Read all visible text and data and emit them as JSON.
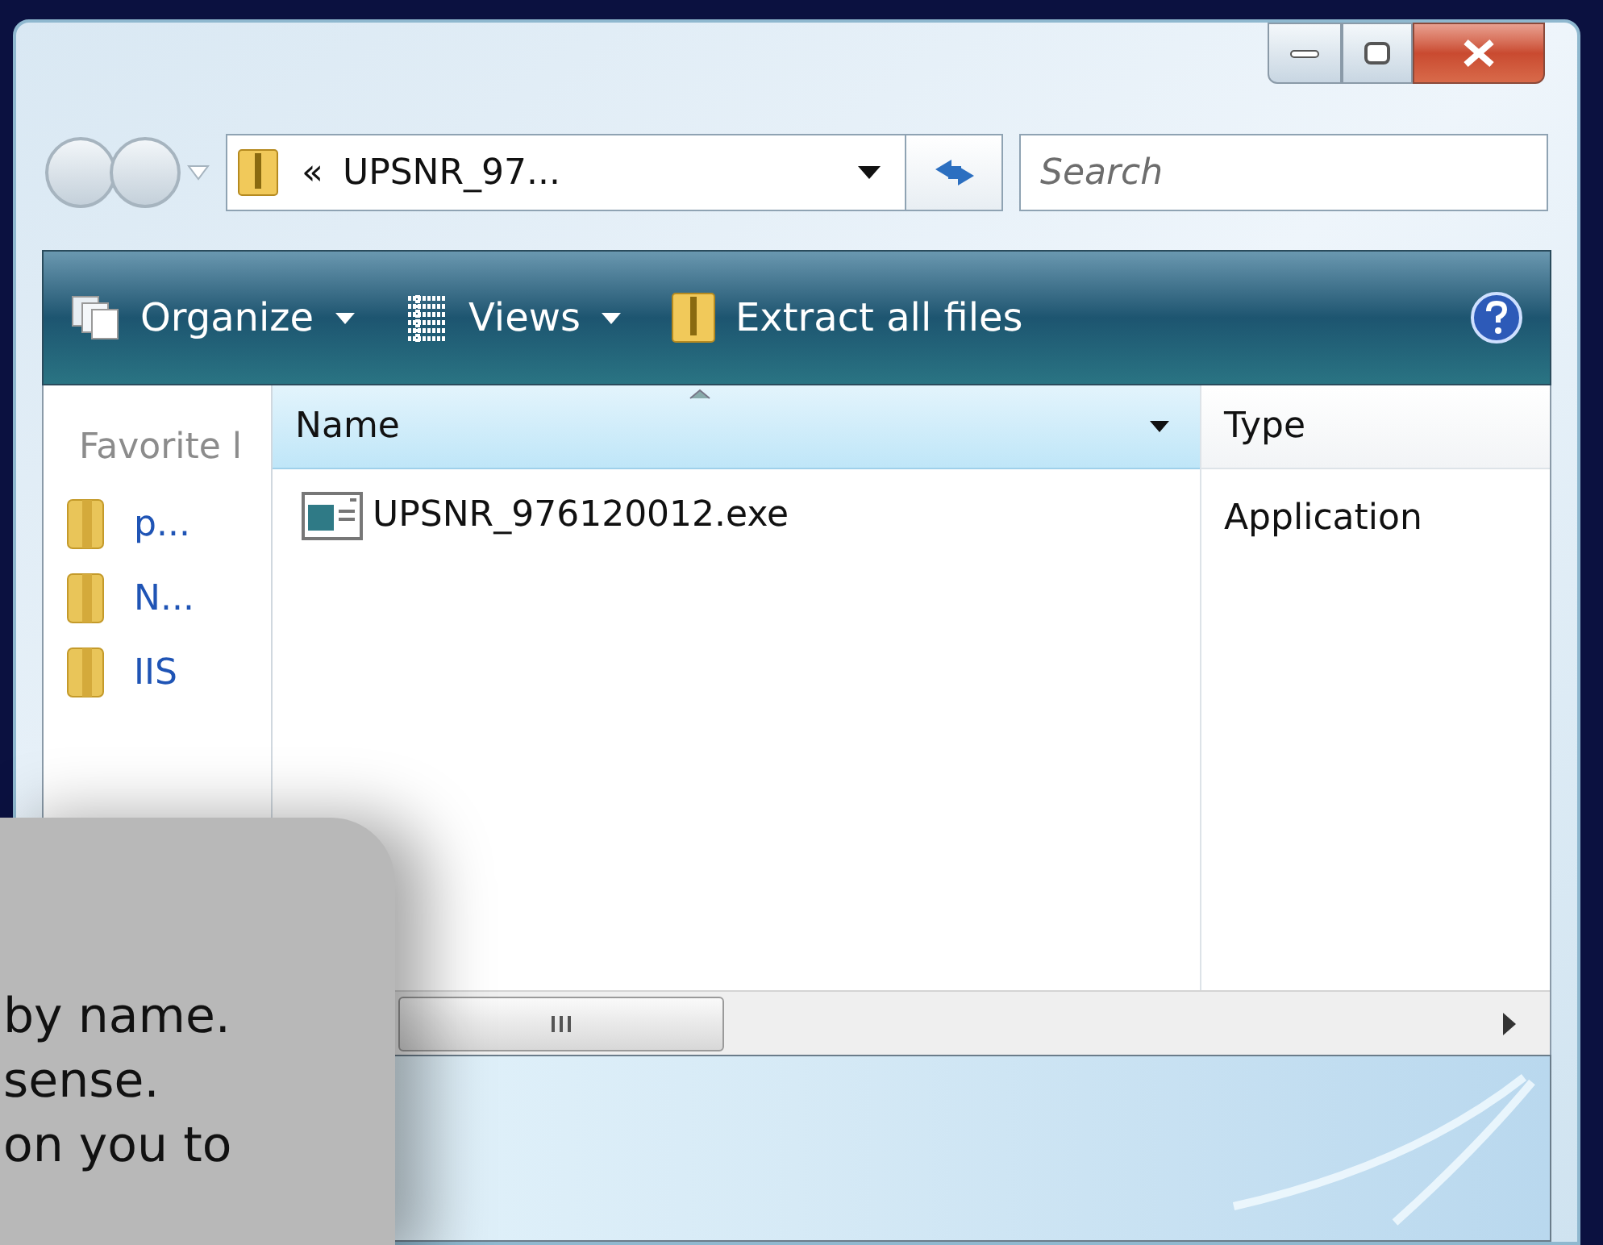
{
  "address": {
    "chevron": "«",
    "path": "UPSNR_97..."
  },
  "search": {
    "placeholder": "Search"
  },
  "toolbar": [
    {
      "label": "Organize",
      "kind": "menu"
    },
    {
      "label": "Views",
      "kind": "menu"
    },
    {
      "label": "Extract all files",
      "kind": "action"
    }
  ],
  "nav_pane": {
    "heading": "Favorite l",
    "items": [
      "p...",
      "N...",
      "IIS"
    ]
  },
  "columns": [
    {
      "label": "Name",
      "sorted": true
    },
    {
      "label": "Type",
      "sorted": false
    }
  ],
  "rows": [
    {
      "name": "UPSNR_976120012.exe",
      "type": "Application"
    }
  ],
  "overlay": {
    "lines": [
      "by name.",
      "sense.",
      "on you to"
    ]
  }
}
